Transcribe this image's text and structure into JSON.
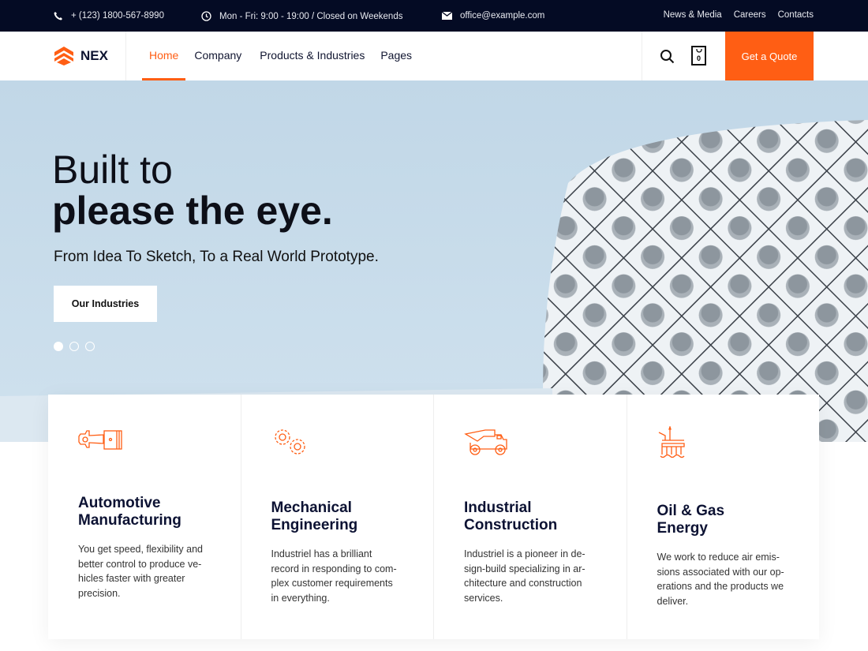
{
  "topbar": {
    "phone": "+ (123) 1800-567-8990",
    "hours": "Mon - Fri: 9:00 - 19:00 / Closed on Weekends",
    "email": "office@example.com",
    "links": [
      "News & Media",
      "Careers",
      "Contacts"
    ]
  },
  "nav": {
    "logo": "NEX",
    "items": [
      "Home",
      "Company",
      "Products & Industries",
      "Pages"
    ],
    "cart_count": "0",
    "quote": "Get a Quote"
  },
  "hero": {
    "line1": "Built to",
    "line2": "please the eye.",
    "subtitle": "From Idea To Sketch, To a Real World Prototype.",
    "button": "Our Industries",
    "slides": 3,
    "active_slide": 1
  },
  "cards": [
    {
      "icon": "piston-icon",
      "title": "Automotive\nManufacturing",
      "text": "You get speed, flexibility and\nbetter control to produce ve-\nhicles faster with greater\nprecision."
    },
    {
      "icon": "gears-icon",
      "title": "Mechanical\nEngineering",
      "text": "Industriel has a brilliant\nrecord in responding to com-\nplex customer requirements\nin everything."
    },
    {
      "icon": "dump-truck-icon",
      "title": "Industrial\nConstruction",
      "text": "Industriel is a pioneer in de-\nsign-build specializing in ar-\nchitecture and construction\nservices."
    },
    {
      "icon": "oil-rig-icon",
      "title": "Oil & Gas\nEnergy",
      "text": "We work to reduce air emis-\nsions associated with our op-\nerations and the products we\ndeliver."
    }
  ],
  "colors": {
    "accent": "#ff5e14",
    "dark": "#040b24",
    "hero_bg": "#c4d9e8"
  }
}
